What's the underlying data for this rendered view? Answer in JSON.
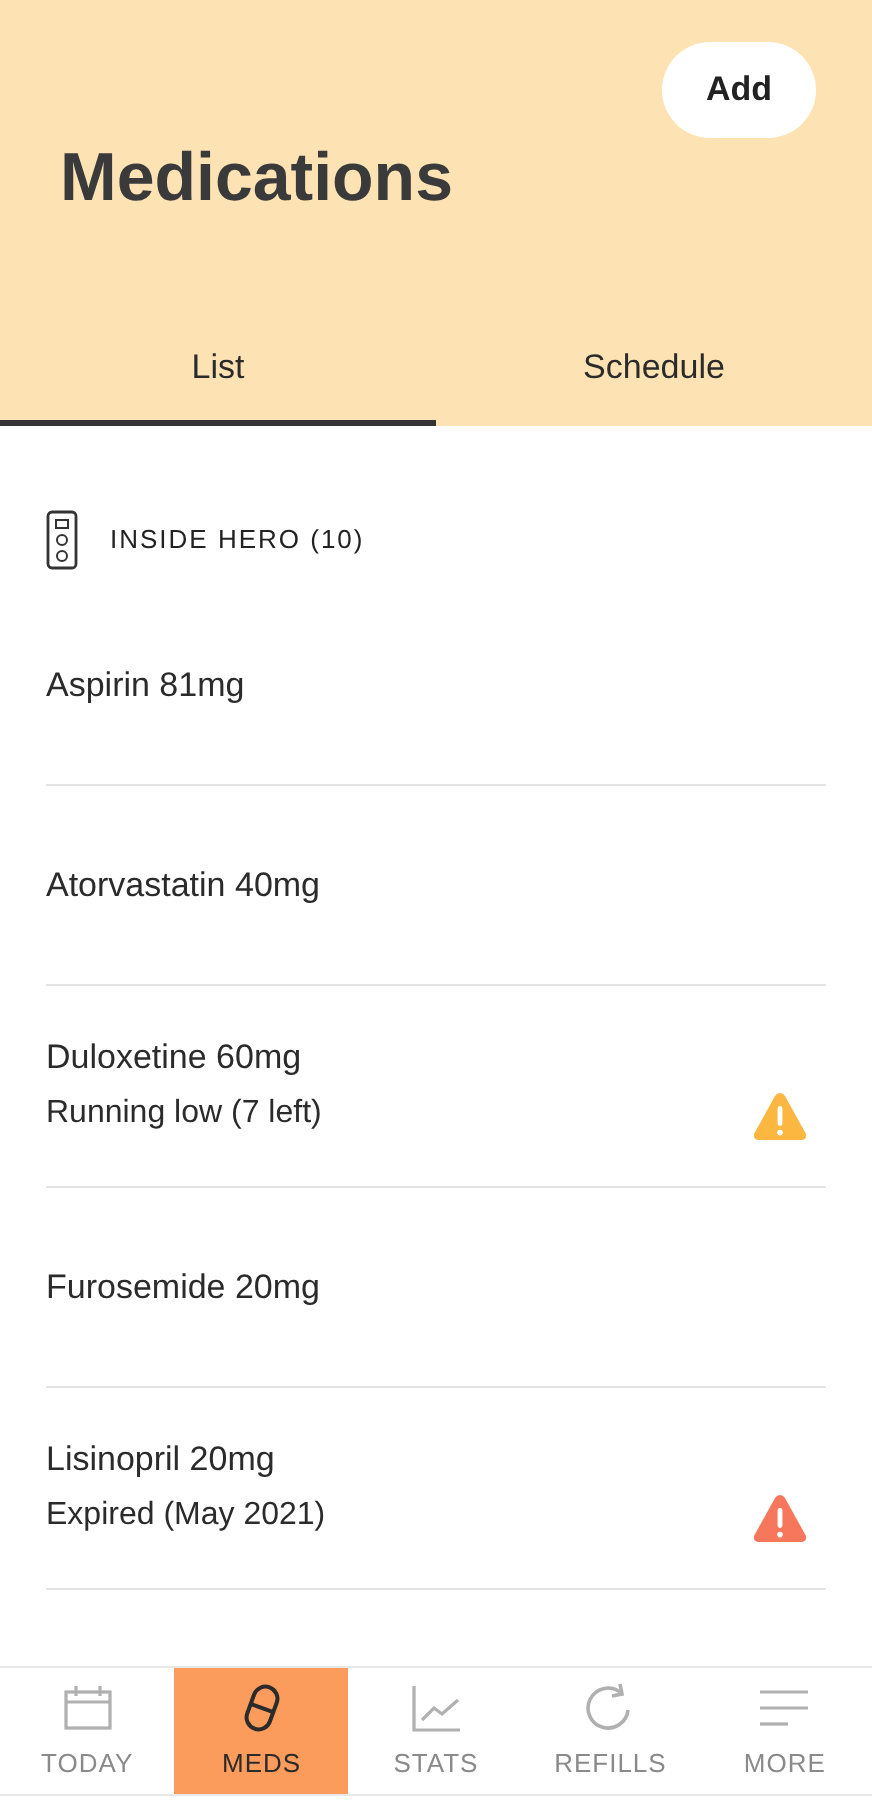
{
  "header": {
    "title": "Medications",
    "add_button": "Add"
  },
  "tabs": [
    {
      "label": "List",
      "selected": true
    },
    {
      "label": "Schedule",
      "selected": false
    }
  ],
  "group": {
    "label": "INSIDE HERO (10)"
  },
  "medications": [
    {
      "name": "Aspirin 81mg"
    },
    {
      "name": "Atorvastatin 40mg"
    },
    {
      "name": "Duloxetine 60mg",
      "status": "Running low (7 left)",
      "color": "#fbb740"
    },
    {
      "name": "Furosemide 20mg"
    },
    {
      "name": "Lisinopril 20mg",
      "status": "Expired (May 2021)",
      "color": "#f6775c"
    }
  ],
  "bottom_nav": [
    {
      "label": "TODAY",
      "selected": false
    },
    {
      "label": "MEDS",
      "selected": true
    },
    {
      "label": "STATS",
      "selected": false
    },
    {
      "label": "REFILLS",
      "selected": false
    },
    {
      "label": "MORE",
      "selected": false
    }
  ]
}
